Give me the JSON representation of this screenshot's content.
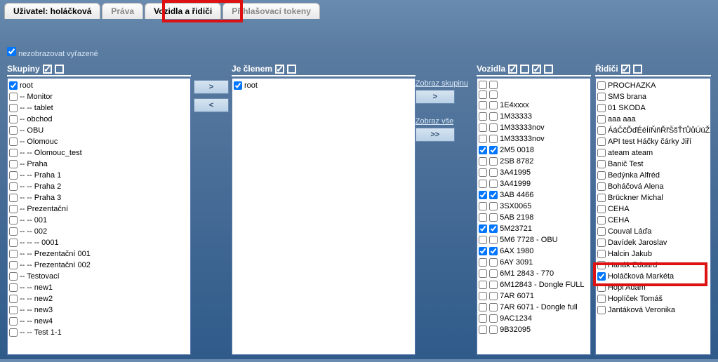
{
  "tabs": {
    "user": "Uživatel:  holáčková",
    "rights": "Práva",
    "vehicles": "Vozidla a řidiči",
    "tokens": "Přihlašovací tokeny"
  },
  "showDisabled": "nezobrazovat vyřazené",
  "headers": {
    "groups": "Skupiny",
    "memberof": "Je členem",
    "vehicles": "Vozidla",
    "drivers": "Řidiči"
  },
  "buttons": {
    "right": ">",
    "left": "<",
    "showGroup": "Zobraz skupinu",
    "showGroupBtn": ">",
    "showAll": "Zobraz vše",
    "showAllBtn": ">>"
  },
  "groups": [
    {
      "c": true,
      "t": "root"
    },
    {
      "c": false,
      "t": "-- Monitor"
    },
    {
      "c": false,
      "t": "-- -- tablet"
    },
    {
      "c": false,
      "t": "-- obchod"
    },
    {
      "c": false,
      "t": "-- OBU"
    },
    {
      "c": false,
      "t": "-- Olomouc"
    },
    {
      "c": false,
      "t": "-- -- Olomouc_test"
    },
    {
      "c": false,
      "t": "-- Praha"
    },
    {
      "c": false,
      "t": "-- -- Praha 1"
    },
    {
      "c": false,
      "t": "-- -- Praha 2"
    },
    {
      "c": false,
      "t": "-- -- Praha 3"
    },
    {
      "c": false,
      "t": "-- Prezentační"
    },
    {
      "c": false,
      "t": "-- -- 001"
    },
    {
      "c": false,
      "t": "-- -- 002"
    },
    {
      "c": false,
      "t": "-- -- -- 0001"
    },
    {
      "c": false,
      "t": "-- -- Prezentační 001"
    },
    {
      "c": false,
      "t": "-- -- Prezentační 002"
    },
    {
      "c": false,
      "t": "-- Testovací"
    },
    {
      "c": false,
      "t": "-- -- new1"
    },
    {
      "c": false,
      "t": "-- -- new2"
    },
    {
      "c": false,
      "t": "-- -- new3"
    },
    {
      "c": false,
      "t": "-- -- new4"
    },
    {
      "c": false,
      "t": "-- -- Test 1-1"
    }
  ],
  "memberof": [
    {
      "c": true,
      "t": "root"
    }
  ],
  "vehicles": [
    {
      "c1": false,
      "c2": false,
      "t": ""
    },
    {
      "c1": false,
      "c2": false,
      "t": ""
    },
    {
      "c1": false,
      "c2": false,
      "t": "1E4xxxx"
    },
    {
      "c1": false,
      "c2": false,
      "t": "1M33333"
    },
    {
      "c1": false,
      "c2": false,
      "t": "1M33333nov"
    },
    {
      "c1": false,
      "c2": false,
      "t": "1M33333nov"
    },
    {
      "c1": true,
      "c2": true,
      "t": "2M5 0018"
    },
    {
      "c1": false,
      "c2": false,
      "t": "2SB 8782"
    },
    {
      "c1": false,
      "c2": false,
      "t": "3A41995"
    },
    {
      "c1": false,
      "c2": false,
      "t": "3A41999"
    },
    {
      "c1": true,
      "c2": true,
      "t": "3AB 4466"
    },
    {
      "c1": false,
      "c2": false,
      "t": "3SX0065"
    },
    {
      "c1": false,
      "c2": false,
      "t": "5AB 2198"
    },
    {
      "c1": true,
      "c2": true,
      "t": "5M23721"
    },
    {
      "c1": false,
      "c2": false,
      "t": "5M6 7728 - OBU"
    },
    {
      "c1": true,
      "c2": true,
      "t": "6AX 1980"
    },
    {
      "c1": false,
      "c2": false,
      "t": "6AY 3091"
    },
    {
      "c1": false,
      "c2": false,
      "t": "6M1 2843 - 770"
    },
    {
      "c1": false,
      "c2": false,
      "t": "6M12843 - Dongle FULL"
    },
    {
      "c1": false,
      "c2": false,
      "t": "7AR 6071"
    },
    {
      "c1": false,
      "c2": false,
      "t": "7AR 6071 - Dongle full"
    },
    {
      "c1": false,
      "c2": false,
      "t": "9AC1234"
    },
    {
      "c1": false,
      "c2": false,
      "t": "9B32095"
    }
  ],
  "drivers": [
    {
      "c": false,
      "t": "PROCHAZKA"
    },
    {
      "c": false,
      "t": "SMS brana"
    },
    {
      "c": false,
      "t": "01 SKODA"
    },
    {
      "c": false,
      "t": "aaa aaa"
    },
    {
      "c": false,
      "t": "ÁáČčĎďÉéÍíŇňŘřŠšŤťŮůÚúŽž Jan"
    },
    {
      "c": false,
      "t": "API test Háčky čárky Jiří"
    },
    {
      "c": false,
      "t": "ateam ateam"
    },
    {
      "c": false,
      "t": "Banič Test"
    },
    {
      "c": false,
      "t": "Bedýnka Alfréd"
    },
    {
      "c": false,
      "t": "Boháčová Alena"
    },
    {
      "c": false,
      "t": "Brückner Michal"
    },
    {
      "c": false,
      "t": "CEHA"
    },
    {
      "c": false,
      "t": "CEHA"
    },
    {
      "c": false,
      "t": "Couval Láďa"
    },
    {
      "c": false,
      "t": "Davídek Jaroslav"
    },
    {
      "c": false,
      "t": "Halcin Jakub"
    },
    {
      "c": false,
      "t": "Hanák Eduard"
    },
    {
      "c": true,
      "t": "Holáčková Markéta"
    },
    {
      "c": false,
      "t": "Hopl Adam"
    },
    {
      "c": false,
      "t": "Hoplíček Tomáš"
    },
    {
      "c": false,
      "t": "Jantáková Veronika"
    }
  ]
}
